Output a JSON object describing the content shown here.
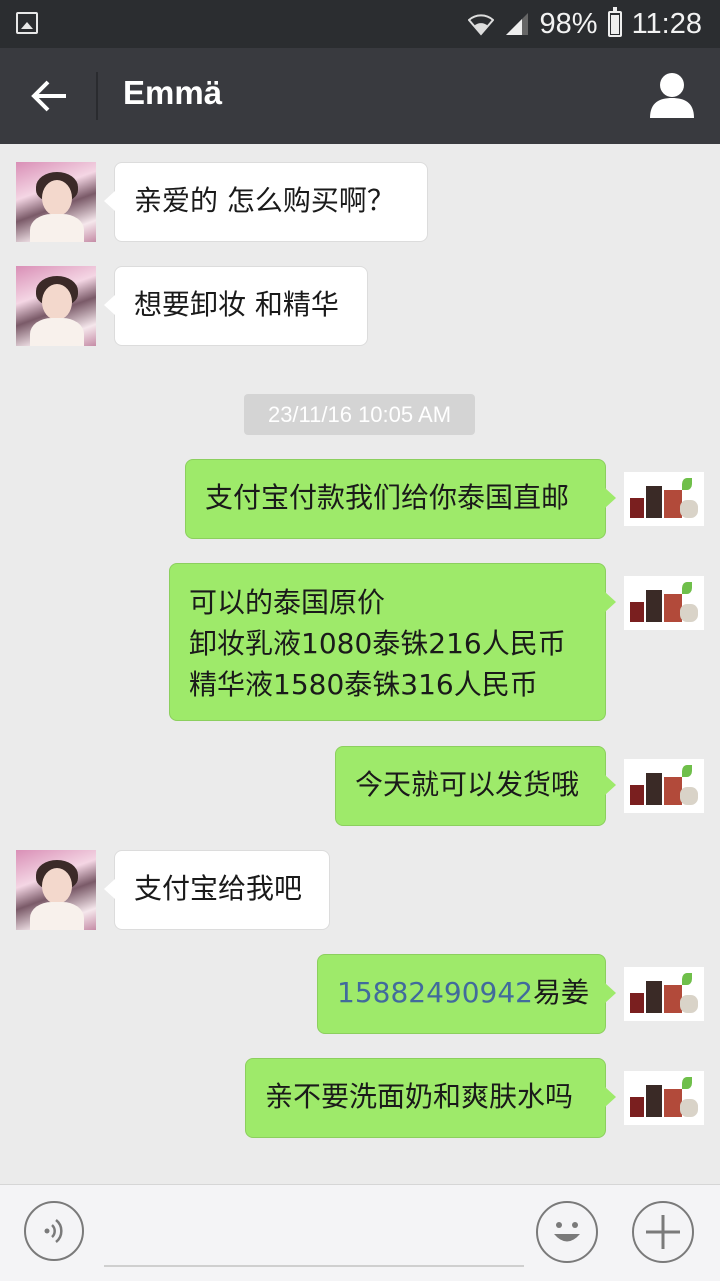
{
  "status_bar": {
    "battery": "98%",
    "time": "11:28"
  },
  "header": {
    "title": "Emmä"
  },
  "timestamp": "23/11/16 10:05 AM",
  "messages": [
    {
      "side": "left",
      "text": "亲爱的 怎么购买啊？"
    },
    {
      "side": "left",
      "text": "想要卸妆 和精华"
    },
    {
      "side": "right",
      "text": "支付宝付款我们给你泰国直邮"
    },
    {
      "side": "right",
      "lines": [
        "可以的泰国原价",
        "卸妆乳液1080泰铢216人民币",
        "精华液1580泰铢316人民币"
      ]
    },
    {
      "side": "right",
      "text": "今天就可以发货哦"
    },
    {
      "side": "left",
      "text": "支付宝给我吧"
    },
    {
      "side": "right",
      "phone": "15882490942",
      "suffix": "易姜"
    },
    {
      "side": "right",
      "text": "亲不要洗面奶和爽肤水吗"
    }
  ],
  "input": {
    "placeholder": ""
  },
  "icons": {
    "back": "back-arrow-icon",
    "profile": "person-icon",
    "voice": "voice-icon",
    "emoji": "emoji-icon",
    "plus": "plus-icon"
  }
}
